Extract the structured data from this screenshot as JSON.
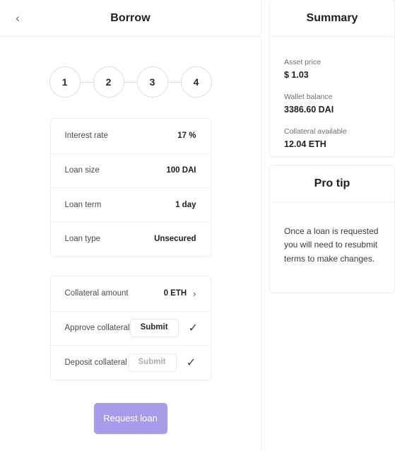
{
  "left": {
    "header": {
      "back_icon": "chevron-left-icon",
      "back_glyph": "‹",
      "title": "Borrow"
    },
    "stepper": {
      "steps": [
        "1",
        "2",
        "3",
        "4"
      ],
      "active_step": 1
    },
    "loan_details": [
      {
        "label": "Interest rate",
        "value": "17 %"
      },
      {
        "label": "Loan size",
        "value": "100 DAI"
      },
      {
        "label": "Loan term",
        "value": "1 day"
      },
      {
        "label": "Loan type",
        "value": "Unsecured"
      }
    ],
    "collateral": {
      "amount_row": {
        "label": "Collateral amount",
        "value": "0 ETH",
        "chevron_glyph": "›"
      },
      "approve_row": {
        "label": "Approve collateral",
        "button_label": "Submit",
        "disabled": false,
        "check_glyph": "✓"
      },
      "deposit_row": {
        "label": "Deposit collateral",
        "button_label": "Submit",
        "disabled": true,
        "check_glyph": "✓"
      }
    },
    "primary_action": {
      "label": "Request loan",
      "color": "#a99aea"
    }
  },
  "right": {
    "summary": {
      "title": "Summary",
      "stats": [
        {
          "label": "Asset price",
          "value": "$ 1.03"
        },
        {
          "label": "Wallet balance",
          "value": "3386.60 DAI"
        },
        {
          "label": "Collateral available",
          "value": "12.04 ETH"
        }
      ]
    },
    "pro_tip": {
      "title": "Pro tip",
      "body": "Once a loan is requested you will need to resubmit terms to make changes."
    }
  }
}
